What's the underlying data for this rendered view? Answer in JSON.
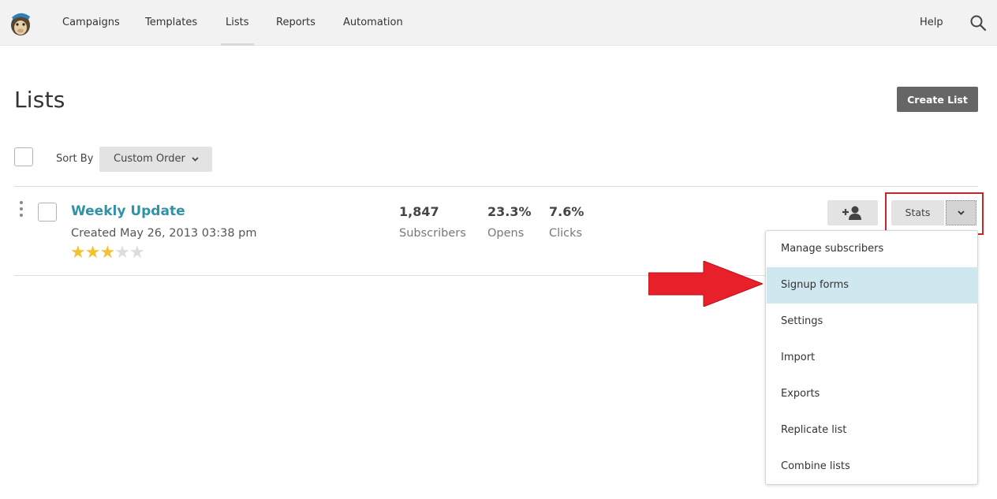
{
  "nav": {
    "items": [
      "Campaigns",
      "Templates",
      "Lists",
      "Reports",
      "Automation"
    ],
    "active": "Lists",
    "help": "Help",
    "logo_icon": "mailchimp-monkey-icon",
    "search_icon": "search-icon"
  },
  "page": {
    "title": "Lists",
    "create_button": "Create List"
  },
  "sort": {
    "label": "Sort By",
    "value": "Custom Order"
  },
  "list": {
    "name": "Weekly Update",
    "created": "Created May 26, 2013 03:38 pm",
    "rating": 3,
    "rating_max": 5,
    "stats": [
      {
        "value": "1,847",
        "label": "Subscribers"
      },
      {
        "value": "23.3%",
        "label": "Opens"
      },
      {
        "value": "7.6%",
        "label": "Clicks"
      }
    ],
    "stats_button": "Stats"
  },
  "menu": {
    "items": [
      "Manage subscribers",
      "Signup forms",
      "Settings",
      "Import",
      "Exports",
      "Replicate list",
      "Combine lists"
    ],
    "highlighted": "Signup forms"
  },
  "colors": {
    "nav_bg": "#f2f2f2",
    "primary_button": "#666666",
    "link": "#2f93a8",
    "star": "#f2c230",
    "menu_highlight": "#cfe8f0",
    "annotation_red": "#e8202a"
  }
}
